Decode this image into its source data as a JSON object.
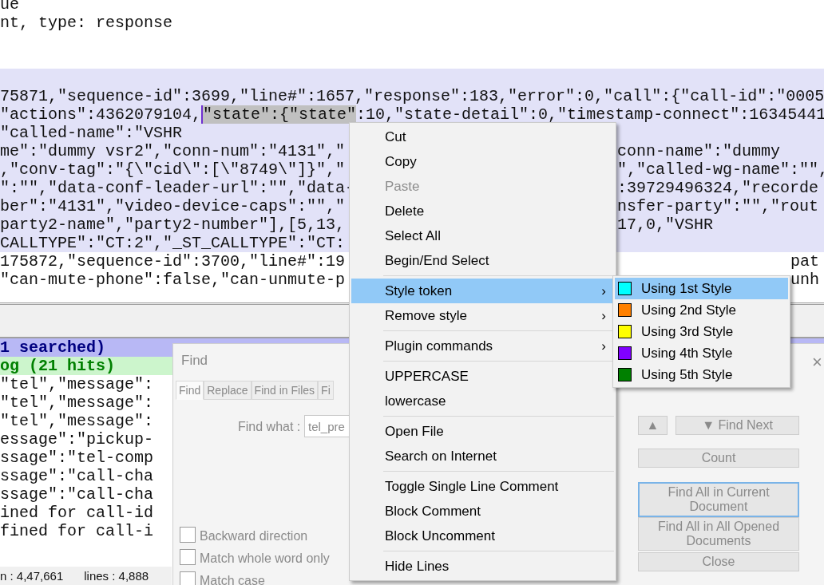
{
  "editor": {
    "lines": [
      {
        "highlighted": false,
        "kind": "text",
        "segments": [
          {
            "text": "ue",
            "selected": false
          }
        ]
      },
      {
        "highlighted": false,
        "kind": "text",
        "segments": [
          {
            "text": "nt, type: response",
            "selected": false
          }
        ]
      },
      {
        "highlighted": false,
        "kind": "blank"
      },
      {
        "highlighted": false,
        "kind": "blank"
      },
      {
        "highlighted": true,
        "kind": "blank"
      },
      {
        "highlighted": true,
        "kind": "text",
        "segments": [
          {
            "text": "75871,\"sequence-id\":3699,\"line#\":1657,\"response\":183,\"error\":0,\"call\":{\"call-id\":\"0005",
            "selected": false
          }
        ]
      },
      {
        "highlighted": true,
        "kind": "text",
        "segments": [
          {
            "text": "\"actions\":4362079104,",
            "selected": false
          },
          {
            "text": "\"state\":{\"state\"",
            "selected": true
          },
          {
            "text": ":10,\"state-detail\":0,\"timestamp-connect\":16345441",
            "selected": false
          }
        ]
      },
      {
        "highlighted": true,
        "kind": "text",
        "segments": [
          {
            "text": "\"called-name\":\"VSHR",
            "selected": false
          }
        ]
      },
      {
        "highlighted": true,
        "kind": "under_menu",
        "segments": [
          {
            "text": "me\":\"dummy vsr2\",\"conn-num\":\"4131\",\"",
            "selected": false
          }
        ],
        "right_text": "conn-name\":\"dummy"
      },
      {
        "highlighted": true,
        "kind": "under_menu",
        "segments": [
          {
            "text": ",\"conv-tag\":\"{\\\"cid\\\":[\\\"8749\\\"]}\",\"",
            "selected": false
          }
        ],
        "right_text": "\",\"called-wg-name\":\"\","
      },
      {
        "highlighted": true,
        "kind": "under_menu",
        "segments": [
          {
            "text": "\":\"\",\"data-conf-leader-url\":\"\",\"data-",
            "selected": false
          }
        ],
        "right_text": ":39729496324,\"recorde"
      },
      {
        "highlighted": true,
        "kind": "under_menu",
        "segments": [
          {
            "text": "ber\":\"4131\",\"video-device-caps\":\"\",\"",
            "selected": false
          }
        ],
        "right_text": "nsfer-party\":\"\",\"rout"
      },
      {
        "highlighted": true,
        "kind": "under_menu",
        "segments": [
          {
            "text": "party2-name\",\"party2-number\"],[5,13,",
            "selected": false
          }
        ],
        "right_text": "17,0,\"VSHR"
      },
      {
        "highlighted": true,
        "kind": "text",
        "segments": [
          {
            "text": "CALLTYPE\":\"CT:2\",\"_ST_CALLTYPE\":\"CT:",
            "selected": false
          }
        ]
      },
      {
        "highlighted": false,
        "kind": "under_submenu",
        "segments": [
          {
            "text": "175872,\"sequence-id\":3700,\"line#\":19",
            "selected": false
          }
        ],
        "right_text": "pat"
      },
      {
        "highlighted": false,
        "kind": "under_submenu",
        "segments": [
          {
            "text": "\"can-mute-phone\":false,\"can-unmute-p",
            "selected": false
          }
        ],
        "right_text": "unh"
      }
    ]
  },
  "search_results": [
    {
      "kind": "search_header",
      "text": "1 searched)"
    },
    {
      "kind": "file_header",
      "text": "og (21 hits)"
    },
    {
      "kind": "hit",
      "text": "\"tel\",\"message\":"
    },
    {
      "kind": "hit",
      "text": "\"tel\",\"message\":"
    },
    {
      "kind": "hit",
      "text": "\"tel\",\"message\":"
    },
    {
      "kind": "hit",
      "text": "essage\":\"pickup-"
    },
    {
      "kind": "hit",
      "text": "ssage\":\"tel-comp"
    },
    {
      "kind": "hit",
      "text": "ssage\":\"call-cha"
    },
    {
      "kind": "hit",
      "text": "ssage\":\"call-cha"
    },
    {
      "kind": "hit",
      "text": "ined for call-id"
    },
    {
      "kind": "hit",
      "text": "fined for call-i"
    }
  ],
  "status_bar": [
    "n : 4,47,661",
    "lines : 4,888"
  ],
  "find_dialog": {
    "title": "Find",
    "close": "×",
    "tabs": [
      {
        "label": "Find",
        "selected": true
      },
      {
        "label": "Replace",
        "selected": false
      },
      {
        "label": "Find in Files",
        "selected": false
      },
      {
        "label": "Fi",
        "selected": false
      }
    ],
    "find_what": {
      "label": "Find what :",
      "value": "tel_pre"
    },
    "options": [
      {
        "label": "Backward direction",
        "checked": false
      },
      {
        "label": "Match whole word only",
        "checked": false
      },
      {
        "label": "Match case",
        "checked": false
      }
    ],
    "buttons": [
      {
        "kind": "up",
        "label": "▲"
      },
      {
        "kind": "next",
        "label": "▼ Find Next"
      },
      {
        "kind": "wide",
        "label": "Count"
      },
      {
        "kind": "focused",
        "label": "Find All in Current Document"
      },
      {
        "kind": "wide",
        "label": "Find All in All Opened Documents"
      },
      {
        "kind": "wide",
        "label": "Close"
      }
    ]
  },
  "context_menu": {
    "items": [
      {
        "kind": "item",
        "label": "Cut",
        "disabled": false,
        "selected": false
      },
      {
        "kind": "item",
        "label": "Copy",
        "disabled": false,
        "selected": false
      },
      {
        "kind": "item",
        "label": "Paste",
        "disabled": true,
        "selected": false
      },
      {
        "kind": "item",
        "label": "Delete",
        "disabled": false,
        "selected": false
      },
      {
        "kind": "item",
        "label": "Select All",
        "disabled": false,
        "selected": false
      },
      {
        "kind": "item",
        "label": "Begin/End Select",
        "disabled": false,
        "selected": false
      },
      {
        "kind": "separator"
      },
      {
        "kind": "submenu",
        "label": "Style token",
        "arrow": "›",
        "disabled": false,
        "selected": true
      },
      {
        "kind": "submenu",
        "label": "Remove style",
        "arrow": "›",
        "disabled": false,
        "selected": false
      },
      {
        "kind": "separator"
      },
      {
        "kind": "submenu",
        "label": "Plugin commands",
        "arrow": "›",
        "disabled": false,
        "selected": false
      },
      {
        "kind": "separator"
      },
      {
        "kind": "item",
        "label": "UPPERCASE",
        "disabled": false,
        "selected": false
      },
      {
        "kind": "item",
        "label": "lowercase",
        "disabled": false,
        "selected": false
      },
      {
        "kind": "separator"
      },
      {
        "kind": "item",
        "label": "Open File",
        "disabled": false,
        "selected": false
      },
      {
        "kind": "item",
        "label": "Search on Internet",
        "disabled": false,
        "selected": false
      },
      {
        "kind": "separator"
      },
      {
        "kind": "item",
        "label": "Toggle Single Line Comment",
        "disabled": false,
        "selected": false
      },
      {
        "kind": "item",
        "label": "Block Comment",
        "disabled": false,
        "selected": false
      },
      {
        "kind": "item",
        "label": "Block Uncomment",
        "disabled": false,
        "selected": false
      },
      {
        "kind": "separator"
      },
      {
        "kind": "item",
        "label": "Hide Lines",
        "disabled": false,
        "selected": false
      }
    ]
  },
  "style_submenu": [
    {
      "label": "Using 1st Style",
      "color": "#00ffff",
      "selected": true
    },
    {
      "label": "Using 2nd Style",
      "color": "#ff8000",
      "selected": false
    },
    {
      "label": "Using 3rd Style",
      "color": "#ffff00",
      "selected": false
    },
    {
      "label": "Using 4th Style",
      "color": "#8000ff",
      "selected": false
    },
    {
      "label": "Using 5th Style",
      "color": "#008000",
      "selected": false
    }
  ]
}
